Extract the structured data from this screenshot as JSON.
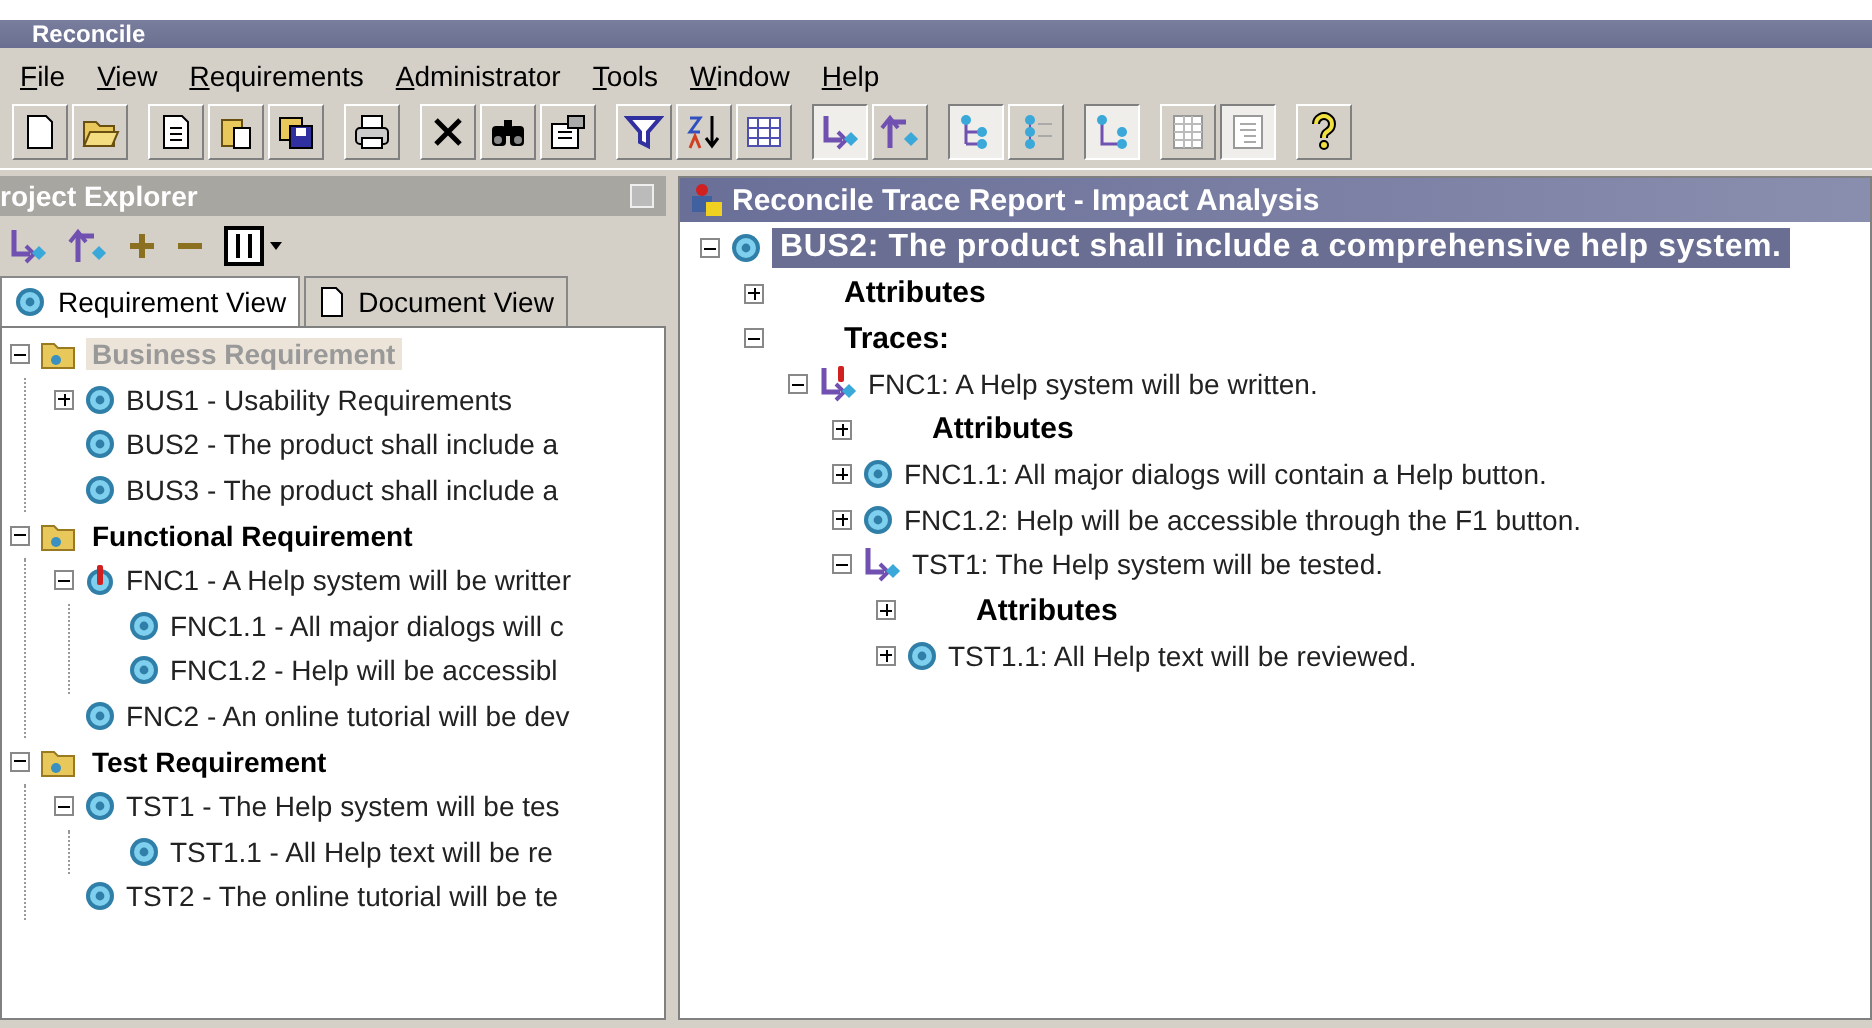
{
  "window": {
    "title": "Reconcile"
  },
  "menu": [
    "File",
    "View",
    "Requirements",
    "Administrator",
    "Tools",
    "Window",
    "Help"
  ],
  "toolbar": [
    [
      {
        "kind": "new",
        "pressed": false
      },
      {
        "kind": "open",
        "pressed": false
      }
    ],
    [
      {
        "kind": "document",
        "pressed": false
      },
      {
        "kind": "paste",
        "pressed": false
      },
      {
        "kind": "save",
        "pressed": false
      }
    ],
    [
      {
        "kind": "print",
        "pressed": false
      }
    ],
    [
      {
        "kind": "delete",
        "pressed": false
      },
      {
        "kind": "find",
        "pressed": false
      },
      {
        "kind": "properties",
        "pressed": false
      }
    ],
    [
      {
        "kind": "filter",
        "pressed": false
      },
      {
        "kind": "sort",
        "pressed": false
      },
      {
        "kind": "columns",
        "pressed": false
      }
    ],
    [
      {
        "kind": "trace-down",
        "pressed": true
      },
      {
        "kind": "trace-up",
        "pressed": false
      }
    ],
    [
      {
        "kind": "tree",
        "pressed": true
      },
      {
        "kind": "list",
        "pressed": false
      }
    ],
    [
      {
        "kind": "hierarchy",
        "pressed": true
      }
    ],
    [
      {
        "kind": "grid",
        "pressed": false
      },
      {
        "kind": "report",
        "pressed": true
      }
    ],
    [
      {
        "kind": "help",
        "pressed": false
      }
    ]
  ],
  "explorer": {
    "title": "roject Explorer",
    "toolbar": [
      {
        "kind": "trace-down"
      },
      {
        "kind": "trace-up"
      },
      {
        "kind": "expand"
      },
      {
        "kind": "collapse"
      },
      {
        "kind": "view-menu"
      }
    ],
    "tabs": [
      {
        "label": "Requirement View",
        "kind": "requirement",
        "selected": true
      },
      {
        "label": "Document View",
        "kind": "document",
        "selected": false
      }
    ],
    "tree": [
      {
        "label": "Business Requirement",
        "kind": "folder",
        "selected": true,
        "expanded": true,
        "children": [
          {
            "label": "BUS1 - Usability Requirements",
            "kind": "req",
            "expanded": false
          },
          {
            "label": "BUS2 - The product shall include a",
            "kind": "req"
          },
          {
            "label": "BUS3 - The product shall include a",
            "kind": "req"
          }
        ]
      },
      {
        "label": "Functional Requirement",
        "kind": "folder",
        "selected": false,
        "expanded": true,
        "children": [
          {
            "label": "FNC1 - A Help system will be writter",
            "kind": "req-flag",
            "expanded": true,
            "children": [
              {
                "label": "FNC1.1 - All major dialogs will c",
                "kind": "req"
              },
              {
                "label": "FNC1.2 - Help will be accessibl",
                "kind": "req"
              }
            ]
          },
          {
            "label": "FNC2 - An online tutorial will be dev",
            "kind": "req"
          }
        ]
      },
      {
        "label": "Test Requirement",
        "kind": "folder",
        "selected": false,
        "expanded": true,
        "children": [
          {
            "label": "TST1 - The Help system will be tes",
            "kind": "req",
            "expanded": true,
            "children": [
              {
                "label": "TST1.1 - All Help text will be re",
                "kind": "req"
              }
            ]
          },
          {
            "label": "TST2 - The online tutorial will be te",
            "kind": "req"
          }
        ]
      }
    ]
  },
  "report": {
    "title": "Reconcile Trace Report - Impact Analysis",
    "tree": [
      {
        "label": "BUS2: The product shall include a comprehensive help system.",
        "kind": "req",
        "selected": true,
        "expanded": true,
        "children": [
          {
            "label": "Attributes",
            "kind": "heading",
            "selected": false,
            "expanded": false
          },
          {
            "label": "Traces:",
            "kind": "heading",
            "selected": false,
            "expanded": true,
            "children": [
              {
                "label": "FNC1: A Help system will be written.",
                "kind": "trace-flag",
                "selected": false,
                "expanded": true,
                "children": [
                  {
                    "label": "Attributes",
                    "kind": "heading",
                    "selected": false,
                    "expanded": false
                  },
                  {
                    "label": "FNC1.1: All major dialogs will contain a Help button.",
                    "kind": "req",
                    "selected": false,
                    "expanded": false
                  },
                  {
                    "label": "FNC1.2: Help will be accessible through the F1 button.",
                    "kind": "req",
                    "selected": false,
                    "expanded": false
                  },
                  {
                    "label": "TST1: The Help system will be tested.",
                    "kind": "trace-down",
                    "selected": false,
                    "expanded": true,
                    "children": [
                      {
                        "label": "Attributes",
                        "kind": "heading",
                        "selected": false,
                        "expanded": false
                      },
                      {
                        "label": "TST1.1: All Help text will be reviewed.",
                        "kind": "req",
                        "selected": false,
                        "expanded": false
                      }
                    ]
                  }
                ]
              }
            ]
          }
        ]
      }
    ]
  }
}
